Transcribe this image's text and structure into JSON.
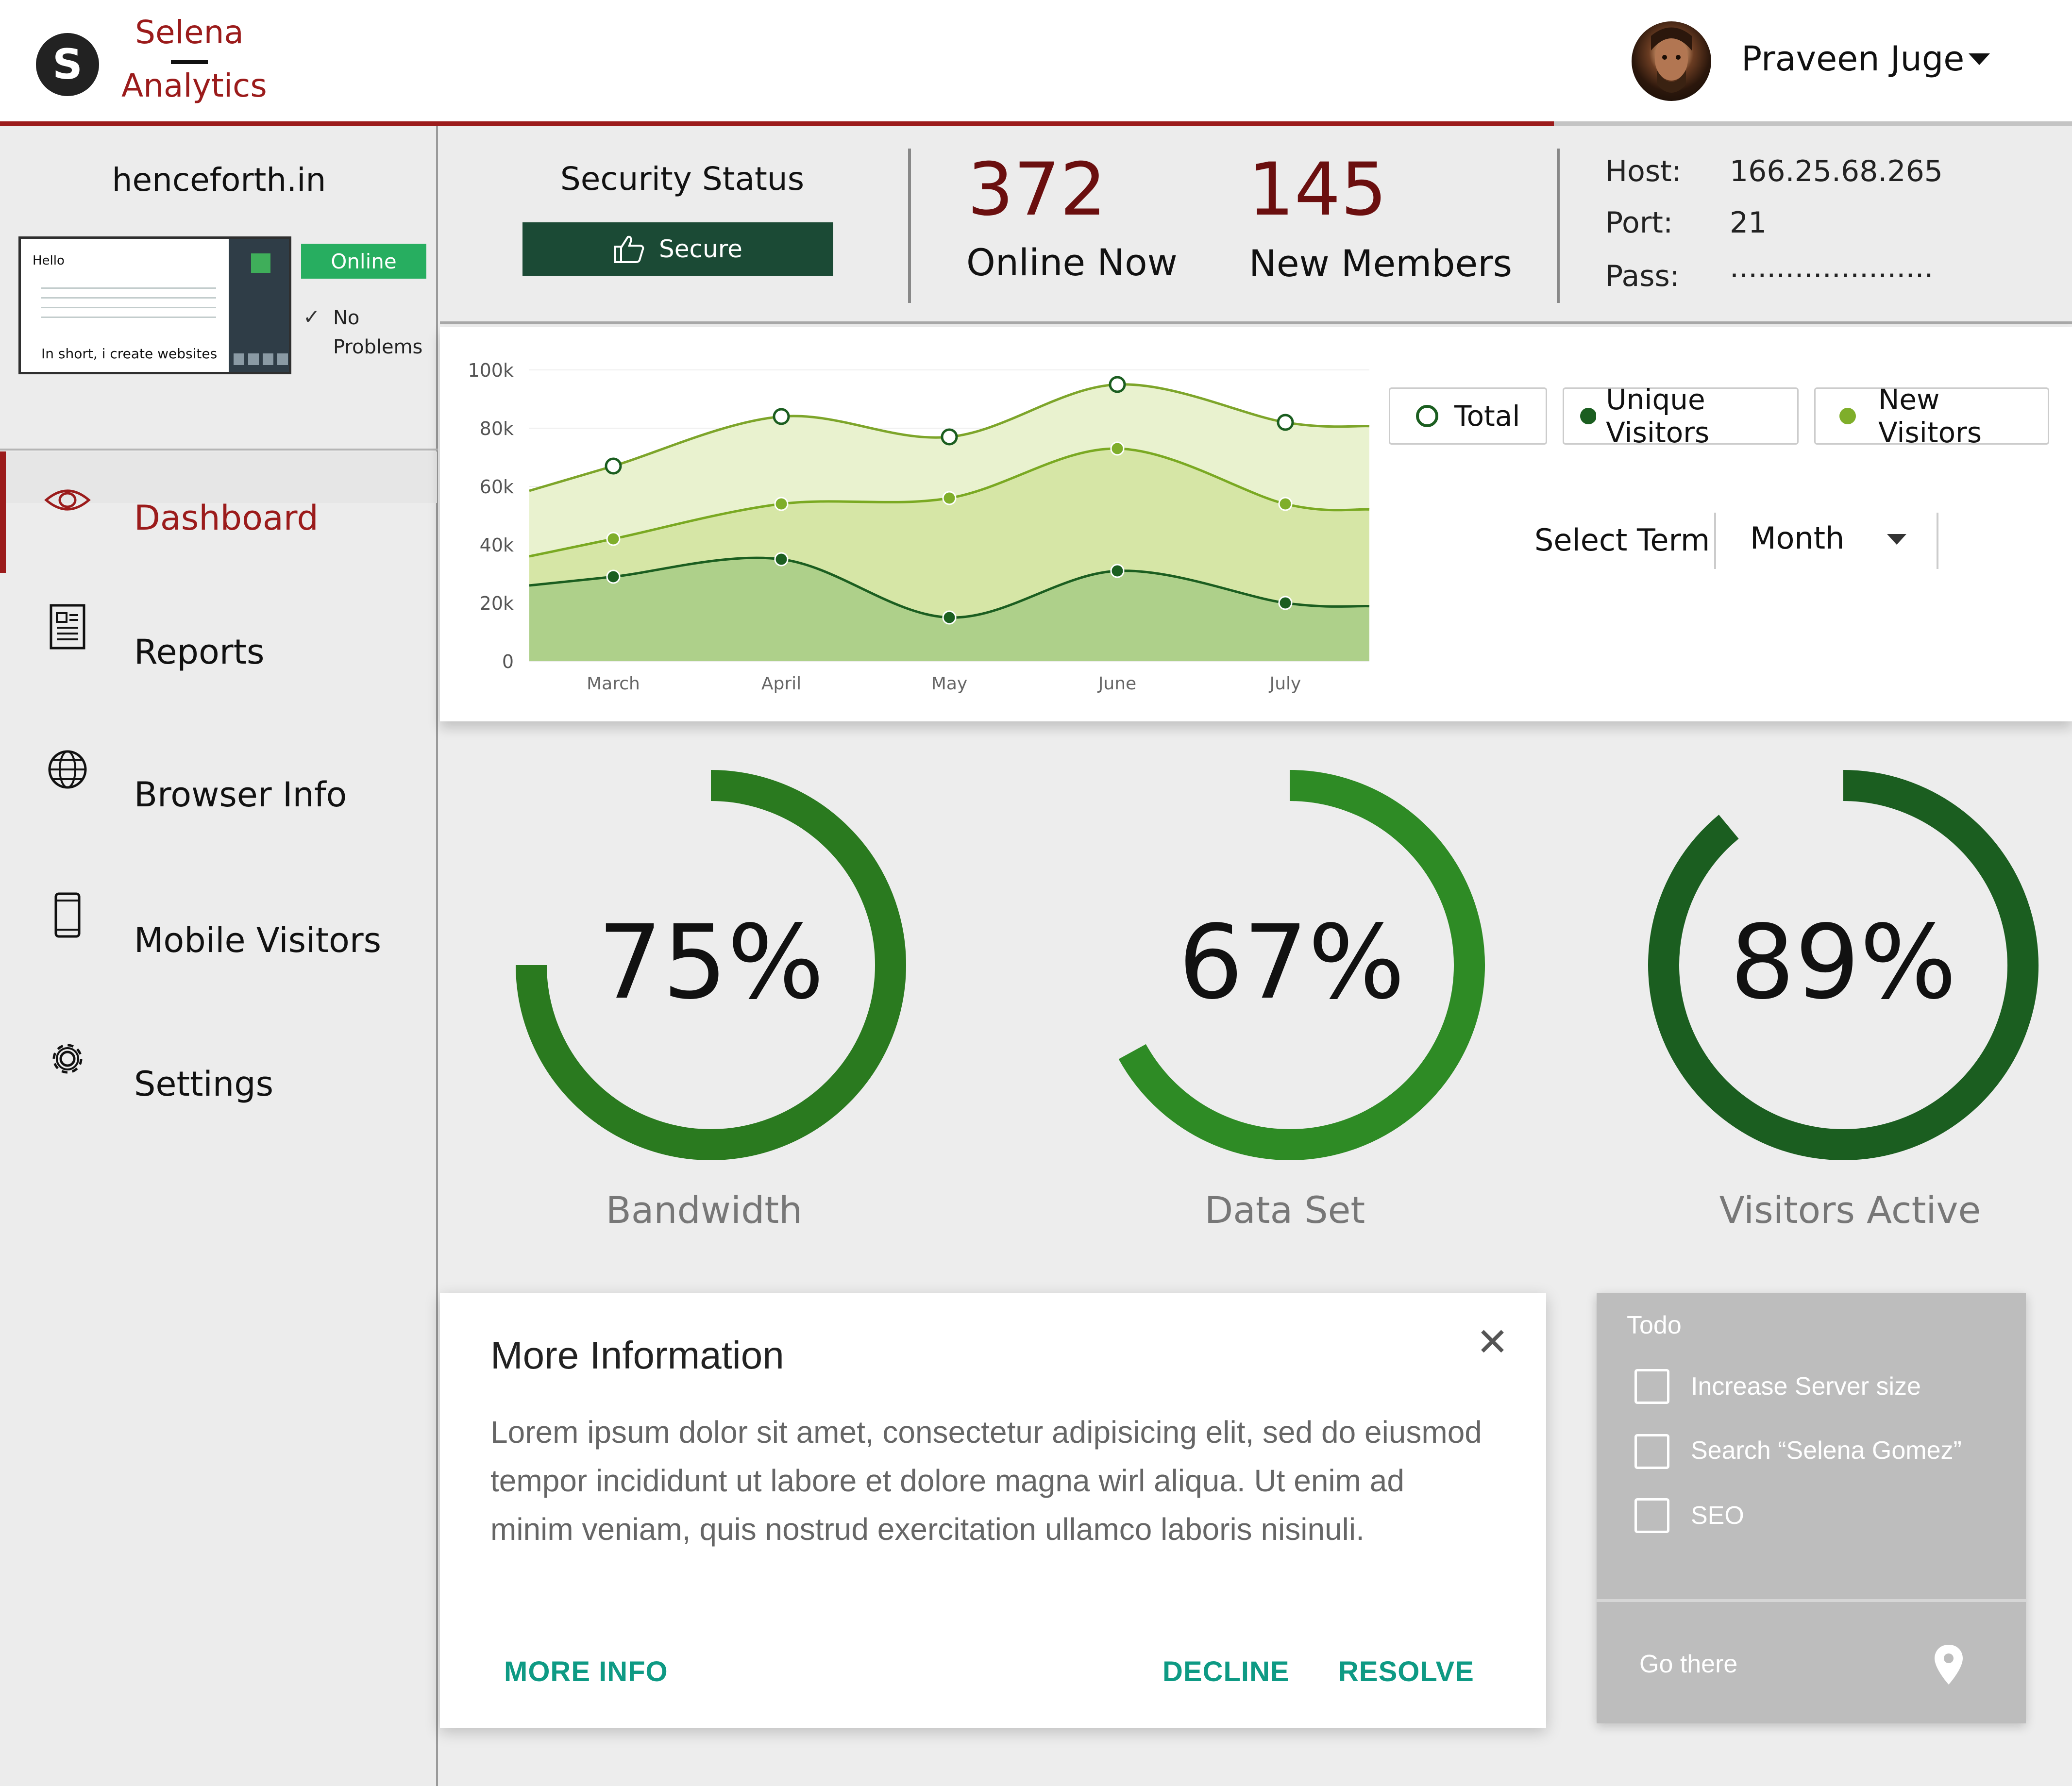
{
  "header": {
    "logo_letter": "S",
    "brand_line1": "Selena",
    "brand_line2": "Analytics",
    "user_name": "Praveen Juge"
  },
  "site": {
    "name": "henceforth.in",
    "thumb_hello": "Hello",
    "thumb_caption": "In short, i create websites",
    "status": "Online",
    "problems_line1": "No",
    "problems_line2": "Problems"
  },
  "nav": [
    {
      "label": "Dashboard",
      "icon": "eye-icon",
      "active": true
    },
    {
      "label": "Reports",
      "icon": "document-icon"
    },
    {
      "label": "Browser Info",
      "icon": "globe-icon"
    },
    {
      "label": "Mobile Visitors",
      "icon": "mobile-icon"
    },
    {
      "label": "Settings",
      "icon": "gear-icon"
    }
  ],
  "security": {
    "title": "Security Status",
    "button": "Secure"
  },
  "stats": {
    "online_value": "372",
    "online_label": "Online Now",
    "members_value": "145",
    "members_label": "New Members"
  },
  "credentials": {
    "host_label": "Host:",
    "host_value": "166.25.68.265",
    "port_label": "Port:",
    "port_value": "21",
    "pass_label": "Pass:",
    "pass_value": "......................"
  },
  "chart_data": {
    "type": "area",
    "categories": [
      "March",
      "April",
      "May",
      "June",
      "July"
    ],
    "ylim": [
      0,
      100000
    ],
    "yticks": [
      "0",
      "20k",
      "40k",
      "60k",
      "80k",
      "100k"
    ],
    "series": [
      {
        "name": "Total",
        "values": [
          67000,
          84000,
          77000,
          95000,
          82000
        ],
        "color": "#7da52a"
      },
      {
        "name": "New Visitors",
        "values": [
          42000,
          54000,
          56000,
          73000,
          54000
        ],
        "color": "#78a91f"
      },
      {
        "name": "Unique Visitors",
        "values": [
          29000,
          35000,
          15000,
          31000,
          20000
        ],
        "color": "#1b5e20"
      }
    ],
    "legend_position": "right"
  },
  "legend": [
    {
      "label": "Total",
      "marker": "hollow",
      "color": "#1b5e20"
    },
    {
      "label": "Unique Visitors",
      "marker": "filled",
      "color": "#1b5e20"
    },
    {
      "label": "New Visitors",
      "marker": "filled",
      "color": "#7fae2a"
    }
  ],
  "term": {
    "label": "Select Term",
    "value": "Month"
  },
  "gauges": [
    {
      "percent_text": "75%",
      "value": 0.75,
      "label": "Bandwidth",
      "color": "#2a7a1f"
    },
    {
      "percent_text": "67%",
      "value": 0.67,
      "label": "Data Set",
      "color": "#2e8b25"
    },
    {
      "percent_text": "89%",
      "value": 0.89,
      "label": "Visitors Active",
      "color": "#1b5e20"
    }
  ],
  "dialog": {
    "title": "More Information",
    "body": "Lorem ipsum dolor sit amet, consectetur adipisicing elit, sed do eiusmod tempor incididunt ut labore et dolore magna wirl aliqua. Ut enim ad minim veniam, quis nostrud exercitation ullamco laboris nisinuli.",
    "more_info": "MORE INFO",
    "decline": "DECLINE",
    "resolve": "RESOLVE"
  },
  "todo": {
    "title": "Todo",
    "items": [
      "Increase Server size",
      "Search “Selena Gomez”",
      "SEO"
    ],
    "footer": "Go there"
  }
}
